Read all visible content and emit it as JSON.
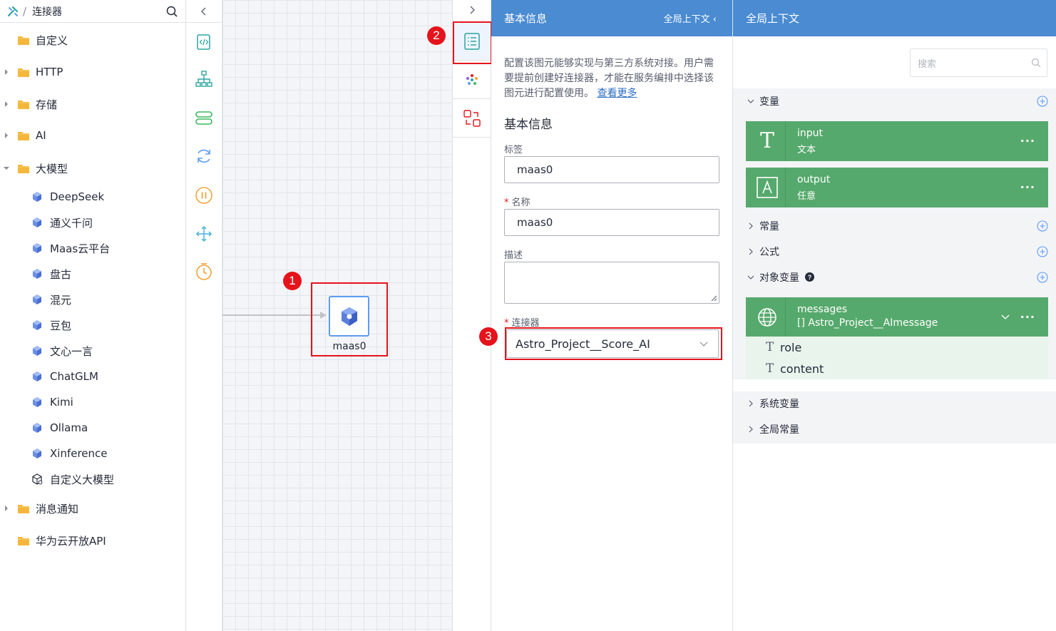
{
  "left_panel": {
    "breadcrumb": "连接器",
    "tree": [
      {
        "label": "自定义",
        "expandable": false
      },
      {
        "label": "HTTP",
        "expandable": true
      },
      {
        "label": "存储",
        "expandable": true
      },
      {
        "label": "AI",
        "expandable": true
      },
      {
        "label": "大模型",
        "expandable": true,
        "expanded": true
      }
    ],
    "models": [
      "DeepSeek",
      "通义千问",
      "Maas云平台",
      "盘古",
      "混元",
      "豆包",
      "文心一言",
      "ChatGLM",
      "Kimi",
      "Ollama",
      "Xinference",
      "自定义大模型"
    ],
    "tree_after": [
      {
        "label": "消息通知",
        "expandable": true
      },
      {
        "label": "华为云开放API",
        "expandable": false
      }
    ]
  },
  "canvas": {
    "node_label": "maas0"
  },
  "markers": [
    "1",
    "2",
    "3"
  ],
  "props_panel": {
    "header_title": "基本信息",
    "header_link": "全局上下文",
    "description": "配置该图元能够实现与第三方系统对接。用户需要提前创建好连接器，才能在服务编排中选择该图元进行配置使用。",
    "learn_more": "查看更多",
    "section_title": "基本信息",
    "label_field": {
      "label": "标签",
      "value": "maas0"
    },
    "name_field": {
      "label": "名称",
      "value": "maas0",
      "required_mark": "*"
    },
    "desc_field": {
      "label": "描述",
      "value": ""
    },
    "connector_field": {
      "label": "连接器",
      "value": "Astro_Project__Score_AI",
      "required_mark": "*"
    }
  },
  "ctx_panel": {
    "header_title": "全局上下文",
    "search_placeholder": "搜索",
    "groups": {
      "variables": "变量",
      "constants": "常量",
      "formulas": "公式",
      "object_variables": "对象变量",
      "system_variables": "系统变量",
      "global_constants": "全局常量"
    },
    "variables": [
      {
        "name": "input",
        "type": "文本"
      },
      {
        "name": "output",
        "type": "任意"
      }
    ],
    "object_variable": {
      "name": "messages",
      "type": "[] Astro_Project__AImessage",
      "fields": [
        "role",
        "content"
      ]
    },
    "colors": {
      "accent": "#4a8bd2",
      "variable_green": "#56a96c",
      "highlight": "#e5141c"
    }
  }
}
